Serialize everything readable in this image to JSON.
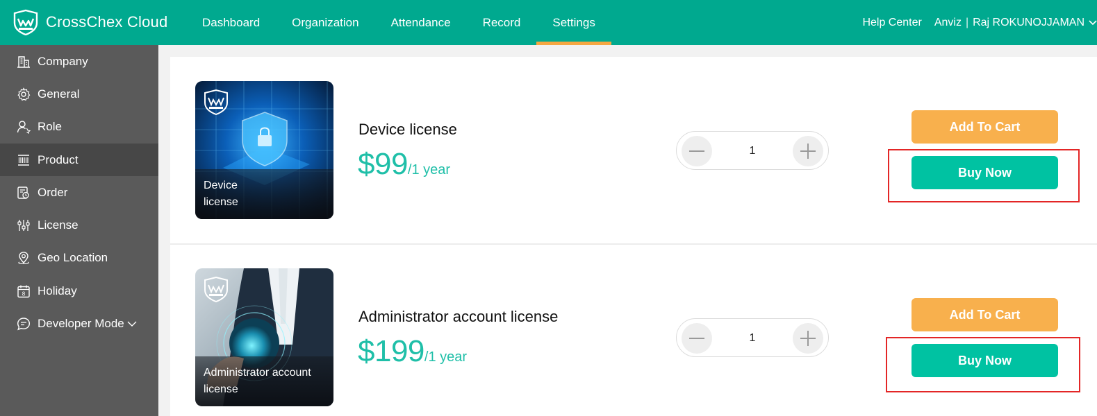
{
  "header": {
    "brand": "CrossChex Cloud",
    "nav": [
      "Dashboard",
      "Organization",
      "Attendance",
      "Record",
      "Settings"
    ],
    "active_nav": "Settings",
    "help": "Help Center",
    "company": "Anviz",
    "separator": "|",
    "user": "Raj ROKUNOJJAMAN"
  },
  "sidebar": {
    "items": [
      {
        "label": "Company",
        "icon": "building-icon"
      },
      {
        "label": "General",
        "icon": "gear-icon"
      },
      {
        "label": "Role",
        "icon": "user-role-icon"
      },
      {
        "label": "Product",
        "icon": "barcode-icon"
      },
      {
        "label": "Order",
        "icon": "order-icon"
      },
      {
        "label": "License",
        "icon": "license-icon"
      },
      {
        "label": "Geo Location",
        "icon": "location-pin-icon"
      },
      {
        "label": "Holiday",
        "icon": "calendar-icon"
      },
      {
        "label": "Developer Mode",
        "icon": "chat-icon"
      }
    ],
    "active": "Product"
  },
  "products": [
    {
      "thumb_caption_1": "Device",
      "thumb_caption_2": "license",
      "name": "Device license",
      "price": "$99",
      "period": "/1 year",
      "quantity": "1",
      "add_to_cart": "Add To Cart",
      "buy_now": "Buy Now"
    },
    {
      "thumb_caption_1": "Administrator account",
      "thumb_caption_2": "license",
      "name": "Administrator account license",
      "price": "$199",
      "period": "/1 year",
      "quantity": "1",
      "add_to_cart": "Add To Cart",
      "buy_now": "Buy Now"
    }
  ],
  "colors": {
    "header": "#00a98f",
    "active_tab_underline": "#f5a742",
    "sidebar": "#5a5a5a",
    "price": "#1fbfa8",
    "add_to_cart": "#f8b04d",
    "buy_now": "#00c2a2",
    "highlight_box": "#e32626"
  }
}
